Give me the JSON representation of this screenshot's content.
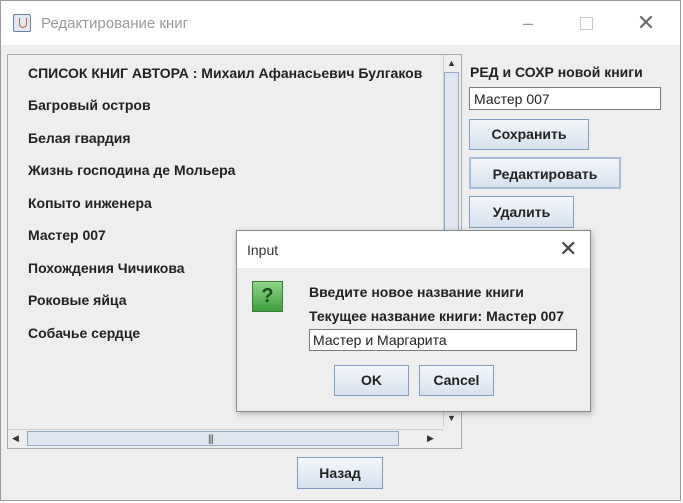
{
  "window": {
    "title": "Редактирование книг",
    "minimize": "–",
    "close": "✕"
  },
  "list": {
    "header": "СПИСОК КНИГ АВТОРА : Михаил Афанасьевич Булгаков",
    "books": [
      "Багровый остров",
      "Белая гвардия",
      "Жизнь господина де Мольера",
      "Копыто инженера",
      "Мастер 007",
      "Похождения Чичикова",
      "Роковые яйца",
      "Собачье сердце"
    ]
  },
  "scroll": {
    "up": "▲",
    "down": "▼",
    "left": "◀",
    "right": "▶",
    "grip": "|||"
  },
  "form": {
    "label": "РЕД и СОХР новой книги",
    "input_value": "Мастер 007",
    "save": "Сохранить",
    "edit": "Редактировать",
    "delete": "Удалить"
  },
  "back": "Назад",
  "dialog": {
    "title": "Input",
    "close": "✕",
    "icon_glyph": "?",
    "prompt": "Введите новое название книги",
    "current": "Текущее название книги: Мастер 007",
    "input_value": "Мастер и Маргарита",
    "ok": "OK",
    "cancel": "Cancel"
  }
}
